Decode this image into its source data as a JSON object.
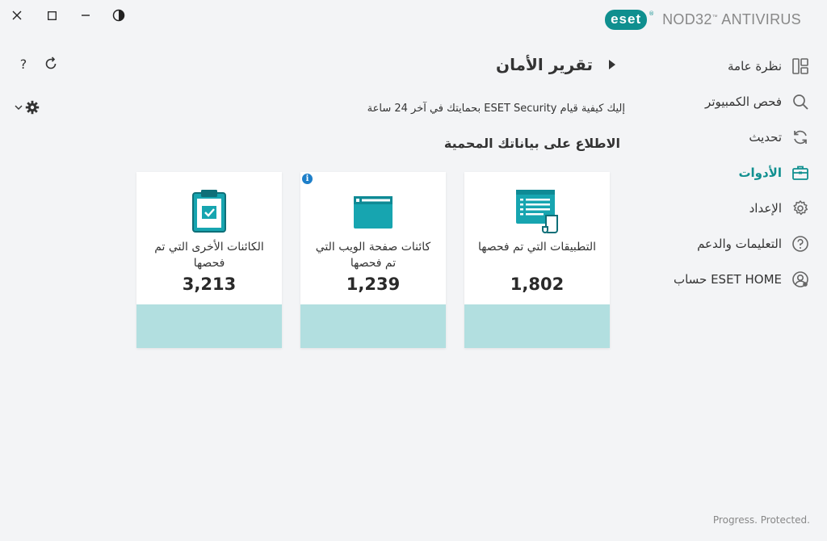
{
  "window": {
    "close_icon": "close-icon",
    "maximize_icon": "maximize-icon",
    "minimize_icon": "minimize-icon",
    "theme_icon": "contrast-icon"
  },
  "brand": {
    "logo_text": "eset",
    "registered": "®",
    "product": "NOD32",
    "product_sup": "™",
    "product_suffix": " ANTIVIRUS",
    "accent_color": "#0f8f8f"
  },
  "toolbar": {
    "help_label": "?",
    "refresh_icon": "refresh-icon",
    "settings_icon": "gear-icon"
  },
  "sidebar": {
    "items": [
      {
        "label": "نظرة عامة",
        "icon": "overview-icon",
        "active": false
      },
      {
        "label": "فحص الكمبيوتر",
        "icon": "search-icon",
        "active": false
      },
      {
        "label": "تحديث",
        "icon": "update-icon",
        "active": false
      },
      {
        "label": "الأدوات",
        "icon": "toolbox-icon",
        "active": true
      },
      {
        "label": "الإعداد",
        "icon": "gear-icon",
        "active": false
      },
      {
        "label": "التعليمات والدعم",
        "icon": "help-icon",
        "active": false
      },
      {
        "label": "حساب ESET HOME",
        "icon": "account-icon",
        "active": false
      }
    ]
  },
  "main": {
    "title": "تقرير الأمان",
    "subtitle": "إليك كيفية قيام ESET Security بحمايتك في آخر 24 ساعة",
    "section_title": "الاطلاع على بياناتك المحمية",
    "cards": [
      {
        "label": "التطبيقات التي تم فحصها",
        "value": "1,802",
        "icon": "applications-icon"
      },
      {
        "label": "كائنات صفحة الويب التي تم فحصها",
        "value": "1,239",
        "icon": "webpage-icon",
        "info": "i"
      },
      {
        "label": "الكائنات الأخرى التي تم فحصها",
        "value": "3,213",
        "icon": "clipboard-check-icon"
      }
    ],
    "bar_color": "#b2dfe0"
  },
  "footer": {
    "tagline": "Progress. Protected."
  }
}
